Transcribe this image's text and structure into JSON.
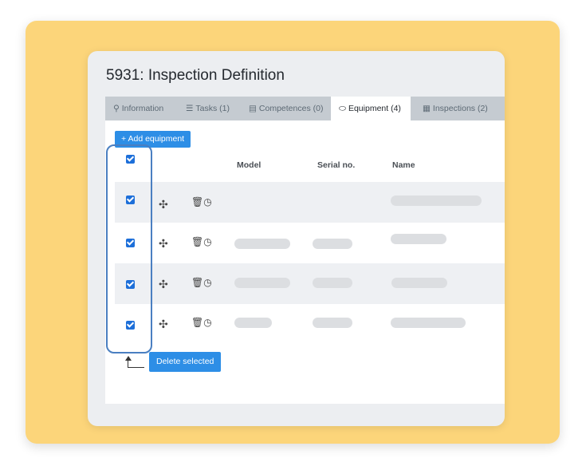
{
  "page": {
    "title": "5931: Inspection Definition"
  },
  "tabs": [
    {
      "label": "Information",
      "icon": "user-icon",
      "active": false
    },
    {
      "label": "Tasks (1)",
      "icon": "list-icon",
      "active": false
    },
    {
      "label": "Competences (0)",
      "icon": "certificate-icon",
      "active": false
    },
    {
      "label": "Equipment (4)",
      "icon": "equipment-icon",
      "active": true
    },
    {
      "label": "Inspections (2)",
      "icon": "calendar-icon",
      "active": false
    }
  ],
  "toolbar": {
    "add_label": "+ Add equipment"
  },
  "table": {
    "columns": [
      "Model",
      "Serial no.",
      "Name"
    ],
    "select_all_checked": true,
    "rows": [
      {
        "checked": true,
        "model": "",
        "serial": "",
        "name": ""
      },
      {
        "checked": true,
        "model": "",
        "serial": "",
        "name": ""
      },
      {
        "checked": true,
        "model": "",
        "serial": "",
        "name": ""
      },
      {
        "checked": true,
        "model": "",
        "serial": "",
        "name": ""
      }
    ]
  },
  "footer": {
    "delete_label": "Delete selected"
  },
  "colors": {
    "accent": "#2d8ee6",
    "checkbox": "#1d6fd9",
    "backdrop": "#fcd57a",
    "selection_outline": "#4a7fc1"
  }
}
